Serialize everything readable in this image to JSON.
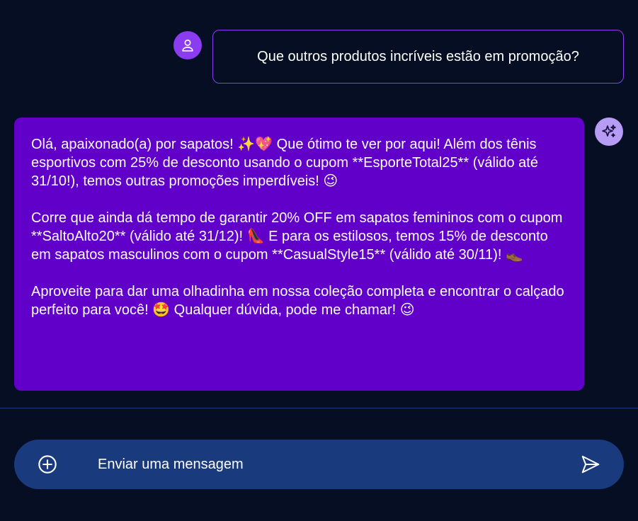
{
  "conversation": {
    "user_message": "Que outros produtos incríveis estão em promoção?",
    "bot_paragraphs": [
      "Olá, apaixonado(a) por sapatos! ✨💖 Que ótimo te ver por aqui! Além dos tênis esportivos com 25% de desconto usando o cupom **EsporteTotal25** (válido até 31/10!), temos outras promoções imperdíveis! 😉",
      "Corre que ainda dá tempo de garantir 20% OFF em sapatos femininos com o cupom **SaltoAlto20** (válido até 31/12)! 👠 E para os estilosos, temos 15% de desconto em sapatos masculinos com o cupom **CasualStyle15** (válido até 30/11)! 👞",
      "Aproveite para dar uma olhadinha em nossa coleção completa e encontrar o calçado perfeito para você! 🤩 Qualquer dúvida, pode me chamar! 😉"
    ]
  },
  "composer": {
    "placeholder": "Enviar uma mensagem",
    "add_icon": "plus-circle-icon",
    "send_icon": "send-icon"
  },
  "icons": {
    "user_avatar": "user-icon",
    "bot_avatar": "sparkles-icon"
  },
  "colors": {
    "background": "#050e23",
    "bot_bubble": "#6000c8",
    "user_bubble_border": "#8a3df5",
    "user_avatar": "#8b3cf0",
    "bot_avatar": "#b79cf5",
    "input_bar": "#1a3a7e"
  }
}
